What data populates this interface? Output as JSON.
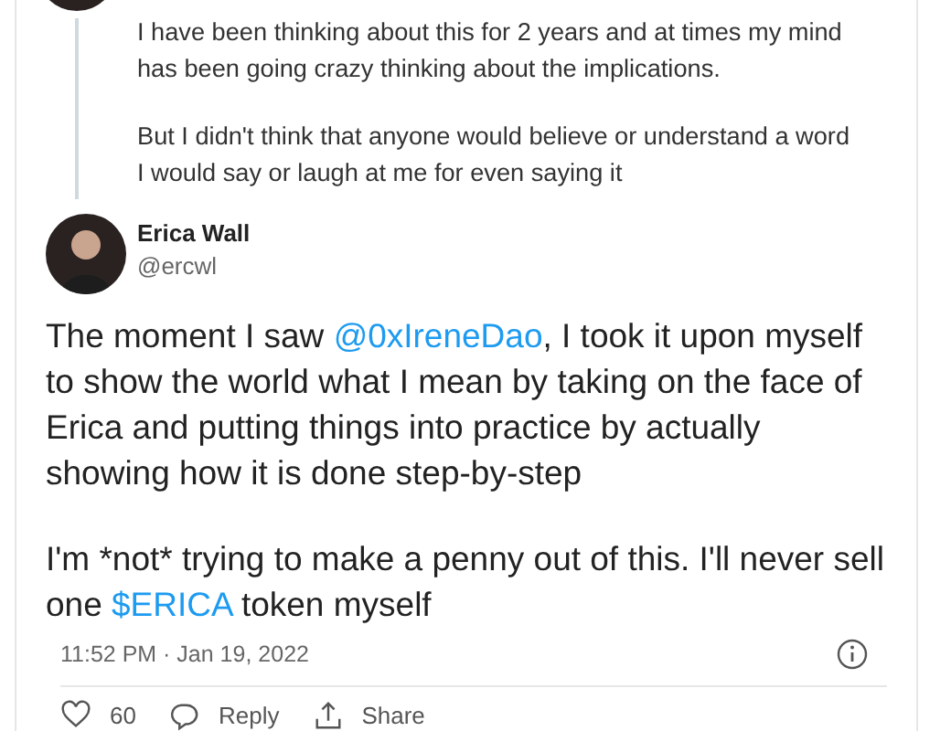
{
  "reply_tweet": {
    "paragraphs": [
      "I have been thinking about this for 2 years and at times my mind has been going crazy thinking about the implications.",
      "But I didn't think that anyone would believe or understand a word I would say or laugh at me for even saying it"
    ]
  },
  "main_tweet": {
    "author": {
      "name": "Erica Wall",
      "handle": "@ercwl"
    },
    "paragraphs": [
      [
        {
          "kind": "text",
          "text": "The moment I saw "
        },
        {
          "kind": "mention",
          "text": "@0xIreneDao"
        },
        {
          "kind": "text",
          "text": ", I took it upon myself to show the world what I mean by taking on the face of Erica and putting things into practice by actually showing how it is done step-by-step"
        }
      ],
      [
        {
          "kind": "text",
          "text": "I'm *not* trying to make a penny out of this. I'll never sell one "
        },
        {
          "kind": "cashtag",
          "text": "$ERICA"
        },
        {
          "kind": "text",
          "text": " token myself"
        }
      ]
    ],
    "timestamp": "11:52 PM · Jan 19, 2022",
    "actions": [
      {
        "kind": "like",
        "label": "60"
      },
      {
        "kind": "reply",
        "label": "Reply"
      },
      {
        "kind": "share",
        "label": "Share"
      }
    ]
  }
}
